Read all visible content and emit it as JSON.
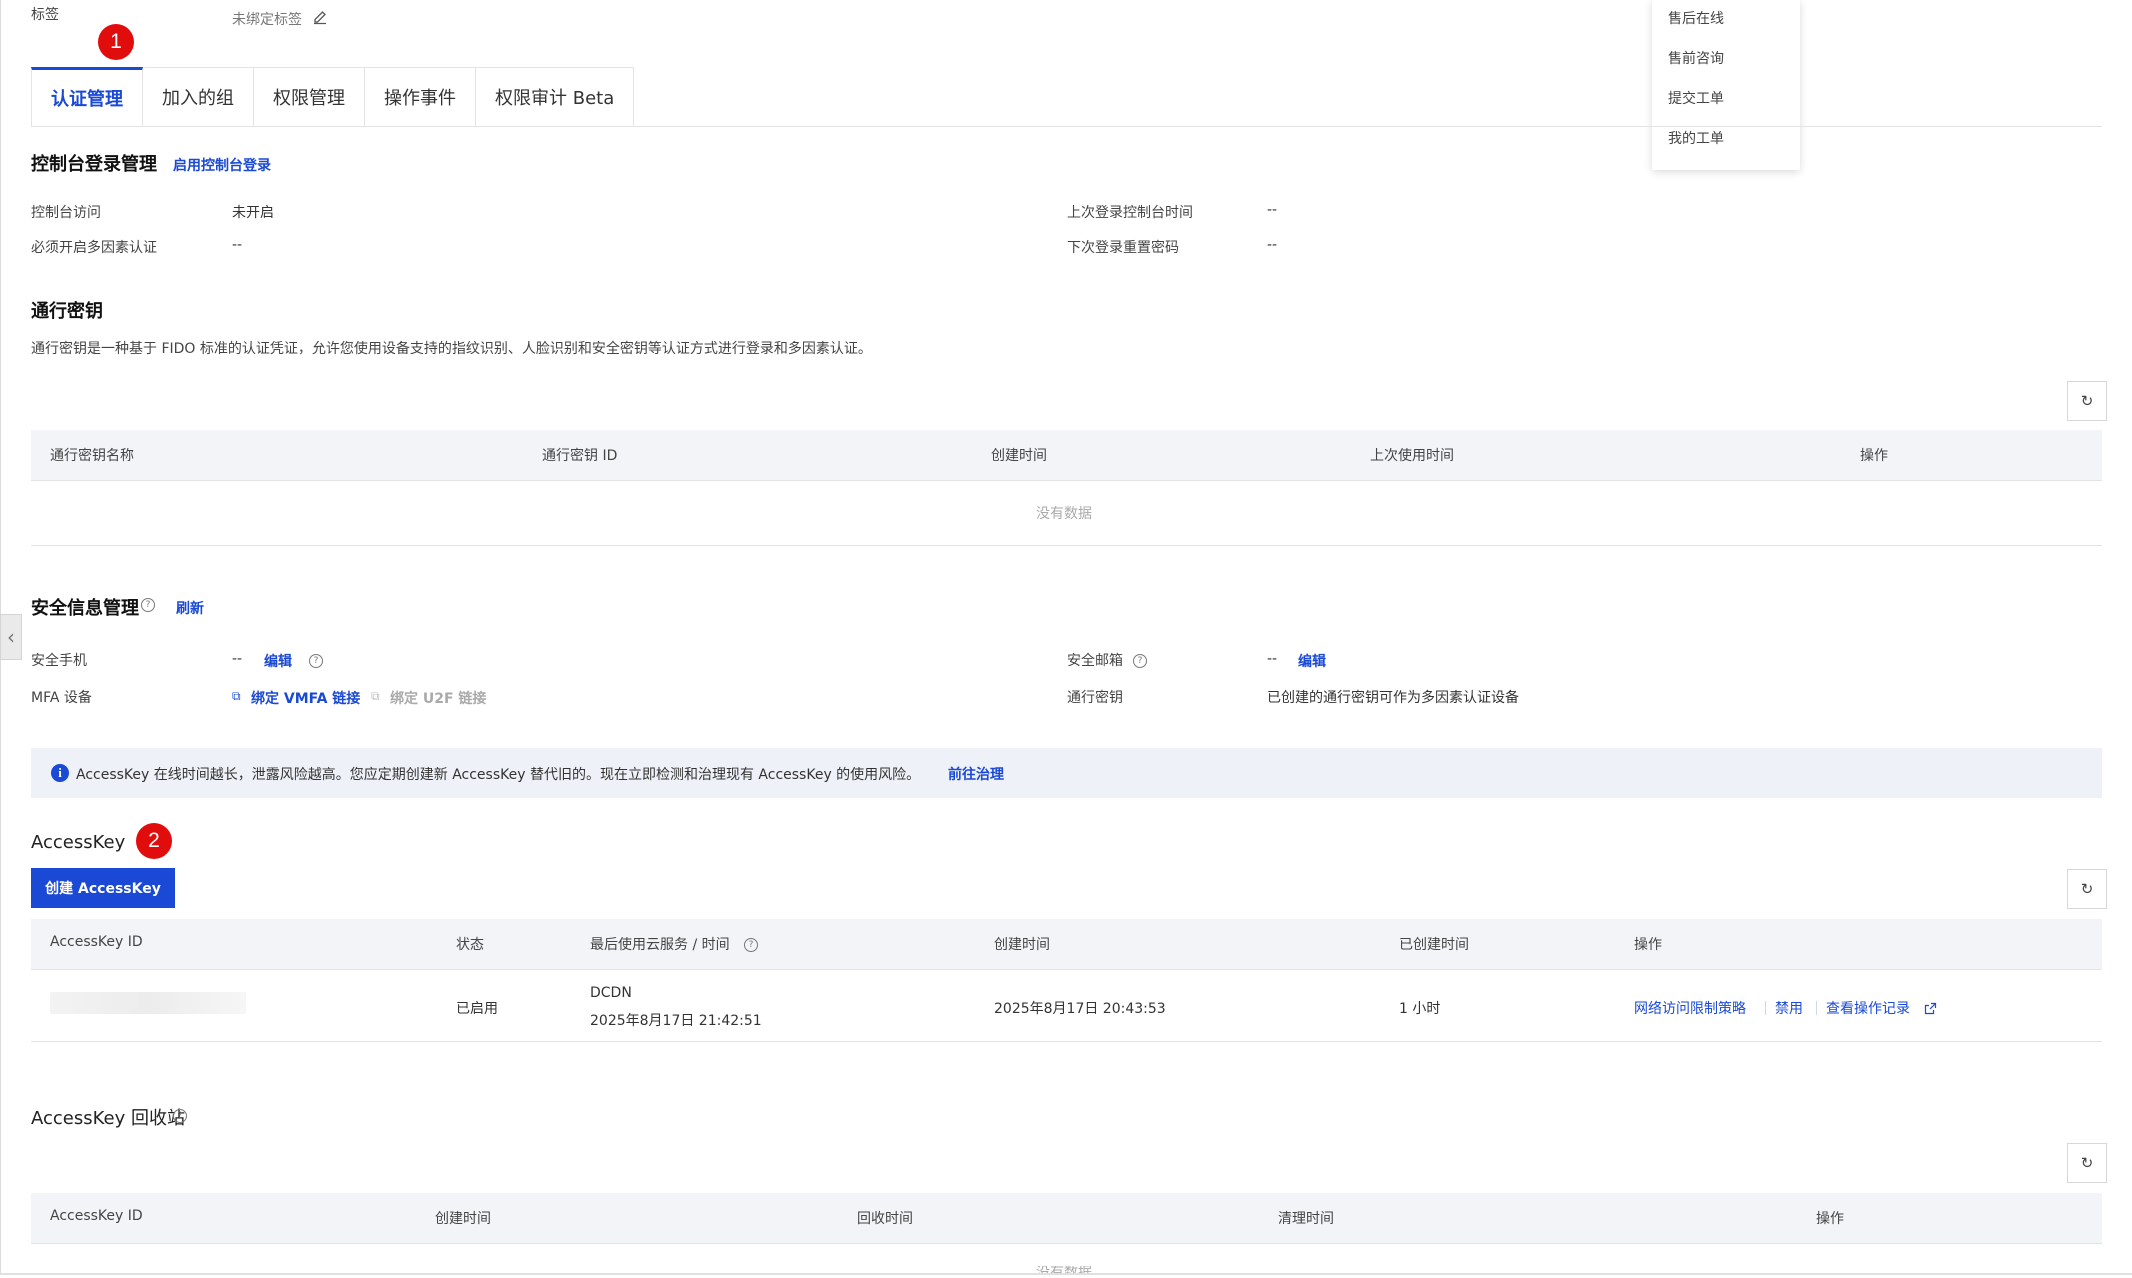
{
  "tags": {
    "label": "标签",
    "value": "未绑定标签"
  },
  "support_menu": {
    "items": [
      "售后在线",
      "售前咨询",
      "提交工单",
      "我的工单"
    ]
  },
  "annotations": {
    "badge1": "1",
    "badge2": "2"
  },
  "tabs": [
    {
      "label": "认证管理",
      "active": true
    },
    {
      "label": "加入的组"
    },
    {
      "label": "权限管理"
    },
    {
      "label": "操作事件"
    },
    {
      "label": "权限审计 Beta"
    }
  ],
  "console_login": {
    "title": "控制台登录管理",
    "enable_link": "启用控制台登录",
    "fields": {
      "console_access_label": "控制台访问",
      "console_access_value": "未开启",
      "mfa_required_label": "必须开启多因素认证",
      "mfa_required_value": "--",
      "last_login_label": "上次登录控制台时间",
      "last_login_value": "--",
      "reset_pwd_label": "下次登录重置密码",
      "reset_pwd_value": "--"
    }
  },
  "passkey": {
    "title": "通行密钥",
    "description": "通行密钥是一种基于 FIDO 标准的认证凭证，允许您使用设备支持的指纹识别、人脸识别和安全密钥等认证方式进行登录和多因素认证。",
    "columns": [
      "通行密钥名称",
      "通行密钥 ID",
      "创建时间",
      "上次使用时间",
      "操作"
    ],
    "empty_text": "没有数据"
  },
  "security": {
    "title": "安全信息管理",
    "refresh_link": "刷新",
    "phone_label": "安全手机",
    "phone_value": "--",
    "phone_edit": "编辑",
    "email_label": "安全邮箱",
    "email_value": "--",
    "email_edit": "编辑",
    "mfa_label": "MFA 设备",
    "mfa_vmfa": "绑定 VMFA 链接",
    "mfa_u2f": "绑定 U2F 链接",
    "passkey_label": "通行密钥",
    "passkey_value": "已创建的通行密钥可作为多因素认证设备"
  },
  "notice": {
    "text": "AccessKey 在线时间越长，泄露风险越高。您应定期创建新 AccessKey 替代旧的。现在立即检测和治理现有 AccessKey 的使用风险。",
    "link": "前往治理"
  },
  "accesskey": {
    "title": "AccessKey",
    "create_button": "创建 AccessKey",
    "columns": [
      "AccessKey ID",
      "状态",
      "最后使用云服务 / 时间",
      "创建时间",
      "已创建时间",
      "操作"
    ],
    "rows": [
      {
        "status": "已启用",
        "last_service": "DCDN",
        "last_time": "2025年8月17日 21:42:51",
        "created": "2025年8月17日 20:43:53",
        "age": "1 小时",
        "actions": [
          "网络访问限制策略",
          "禁用",
          "查看操作记录"
        ]
      }
    ]
  },
  "recycle": {
    "title": "AccessKey 回收站",
    "columns": [
      "AccessKey ID",
      "创建时间",
      "回收时间",
      "清理时间",
      "操作"
    ],
    "empty_text": "没有数据"
  },
  "colors": {
    "primary": "#1a49d6",
    "badge": "#e10c0c",
    "header_bg": "#f2f4f8"
  }
}
